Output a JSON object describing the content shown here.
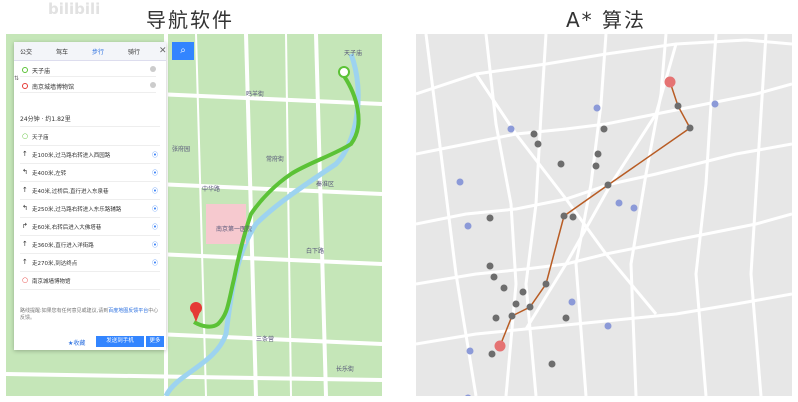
{
  "titles": {
    "left": "导航软件",
    "right": "A* 算法"
  },
  "watermark": "bilibili",
  "nav": {
    "modes": [
      "公交",
      "驾车",
      "步行",
      "骑行"
    ],
    "active_mode": "步行",
    "close_icon": "close-icon",
    "search_icon": "search-icon",
    "start": "天子庙",
    "end": "南京城墙博物馆",
    "summary": "24分钟 · 约1.82里",
    "steps": [
      {
        "icon": "start-dot-icon",
        "text": "天子庙"
      },
      {
        "icon": "straight-arrow-icon",
        "text": "走100米,过马路右转进入西园路"
      },
      {
        "icon": "turn-left-icon",
        "text": "走400米,左转"
      },
      {
        "icon": "straight-arrow-icon",
        "text": "走40米,过桥后,直行进入东泉巷"
      },
      {
        "icon": "turn-left-icon",
        "text": "走250米,过马路右转进入东乐路辅路"
      },
      {
        "icon": "turn-right-icon",
        "text": "走60米,右转后进入大佛塔巷"
      },
      {
        "icon": "straight-arrow-icon",
        "text": "走360米,直行进入洋街路"
      },
      {
        "icon": "straight-arrow-icon",
        "text": "走270米,到达终点"
      },
      {
        "icon": "end-dot-icon",
        "text": "南京城墙博物馆"
      }
    ],
    "suggestion": "路线提醒:如果您有任何意见或建议,请到",
    "suggestion_link": "百度地图反馈平台",
    "suggestion_tail": "中心反馈。",
    "fav_label": "收藏",
    "send_label": "发送到手机",
    "more_label": "更多"
  },
  "map_labels": [
    "天子庙",
    "南京第一医院",
    "秦淮区",
    "鸣羊街",
    "张府园",
    "中华路",
    "常府街",
    "白下路",
    "三条营",
    "长乐街"
  ],
  "colors": {
    "route": "#5bc236",
    "road": "#ffffff",
    "river": "#9dd3f0",
    "path": "#b85c24",
    "start_node": "#e57373",
    "gray_node": "#6d6d6d",
    "blue_node": "#8c9ad8"
  }
}
